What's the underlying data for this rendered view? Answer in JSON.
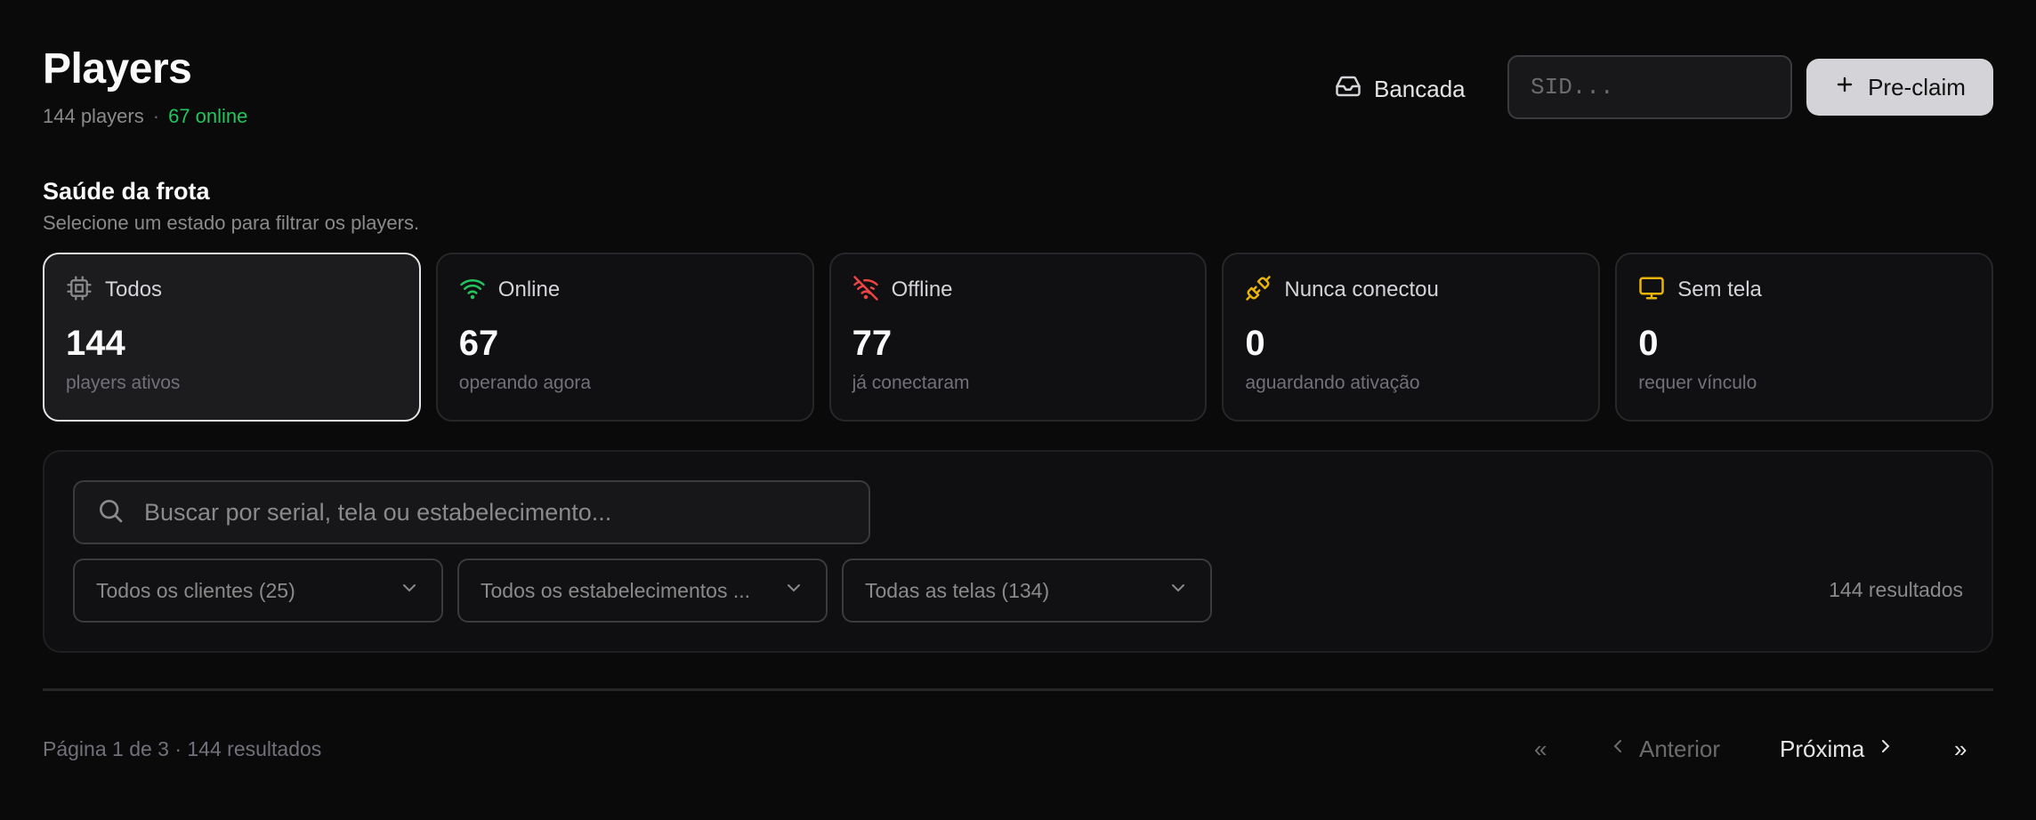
{
  "header": {
    "title": "Players",
    "count_text": "144 players",
    "separator": "·",
    "online_text": "67 online",
    "bancada_label": "Bancada",
    "sid_placeholder": "SID...",
    "preclaim_label": "Pre-claim"
  },
  "health": {
    "title": "Saúde da frota",
    "subtitle": "Selecione um estado para filtrar os players.",
    "cards": [
      {
        "icon": "chip-icon",
        "label": "Todos",
        "value": "144",
        "desc": "players ativos",
        "icon_color": "#8a8a8a",
        "active": true
      },
      {
        "icon": "wifi-icon",
        "label": "Online",
        "value": "67",
        "desc": "operando agora",
        "icon_color": "#22c55e",
        "active": false
      },
      {
        "icon": "wifi-off-icon",
        "label": "Offline",
        "value": "77",
        "desc": "já conectaram",
        "icon_color": "#ef4444",
        "active": false
      },
      {
        "icon": "plug-icon",
        "label": "Nunca conectou",
        "value": "0",
        "desc": "aguardando ativação",
        "icon_color": "#eab308",
        "active": false
      },
      {
        "icon": "monitor-icon",
        "label": "Sem tela",
        "value": "0",
        "desc": "requer vínculo",
        "icon_color": "#eab308",
        "active": false
      }
    ]
  },
  "filters": {
    "search_placeholder": "Buscar por serial, tela ou estabelecimento...",
    "clients": "Todos os clientes (25)",
    "establishments": "Todos os estabelecimentos ...",
    "screens": "Todas as telas (134)",
    "results": "144 resultados"
  },
  "pagination": {
    "info": "Página 1 de 3 · 144 resultados",
    "first": "«",
    "prev": "Anterior",
    "next": "Próxima",
    "last": "»"
  }
}
